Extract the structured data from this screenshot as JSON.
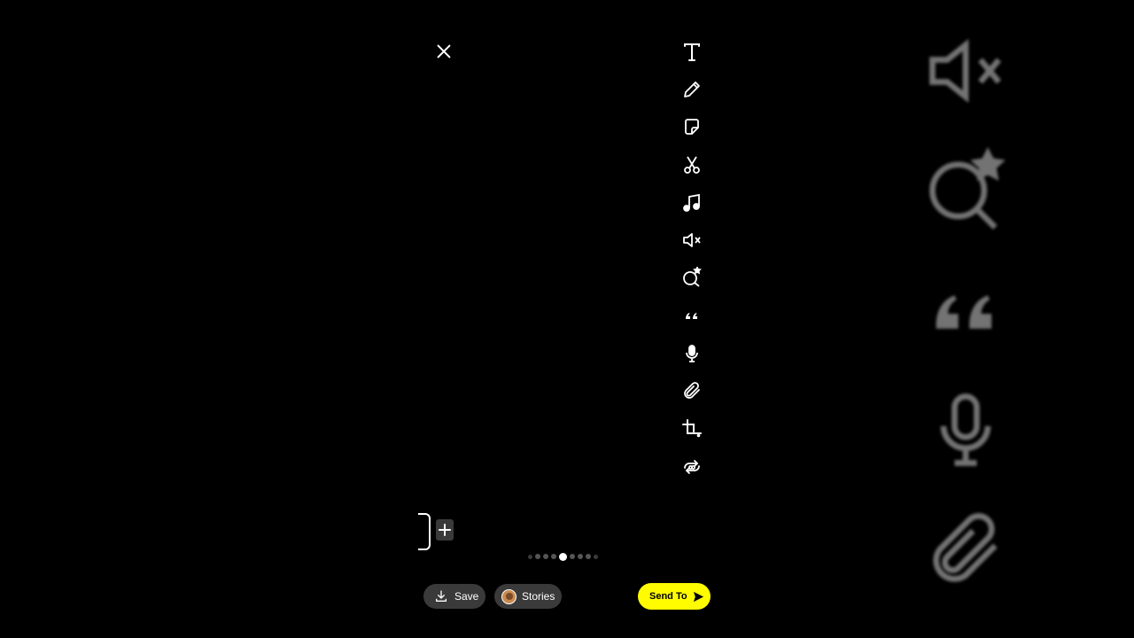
{
  "toolbar": {
    "tools": [
      {
        "name": "text",
        "icon": "text-icon"
      },
      {
        "name": "draw",
        "icon": "pencil-icon"
      },
      {
        "name": "sticker",
        "icon": "sticker-icon"
      },
      {
        "name": "scissors",
        "icon": "scissors-icon"
      },
      {
        "name": "music",
        "icon": "music-note-icon"
      },
      {
        "name": "mute",
        "icon": "speaker-muted-icon"
      },
      {
        "name": "lens",
        "icon": "lens-search-icon"
      },
      {
        "name": "quote",
        "icon": "quote-icon"
      },
      {
        "name": "voiceover",
        "icon": "microphone-icon"
      },
      {
        "name": "attachment",
        "icon": "paperclip-icon"
      },
      {
        "name": "crop",
        "icon": "crop-icon"
      },
      {
        "name": "loop",
        "icon": "loop-icon"
      }
    ]
  },
  "pager": {
    "total": 9,
    "active_index": 4
  },
  "bottom_bar": {
    "save_label": "Save",
    "stories_label": "Stories",
    "send_label": "Send To"
  },
  "colors": {
    "background": "#000000",
    "pill": "#3a3a3a",
    "send_accent": "#fffc00",
    "icon": "#ffffff"
  }
}
